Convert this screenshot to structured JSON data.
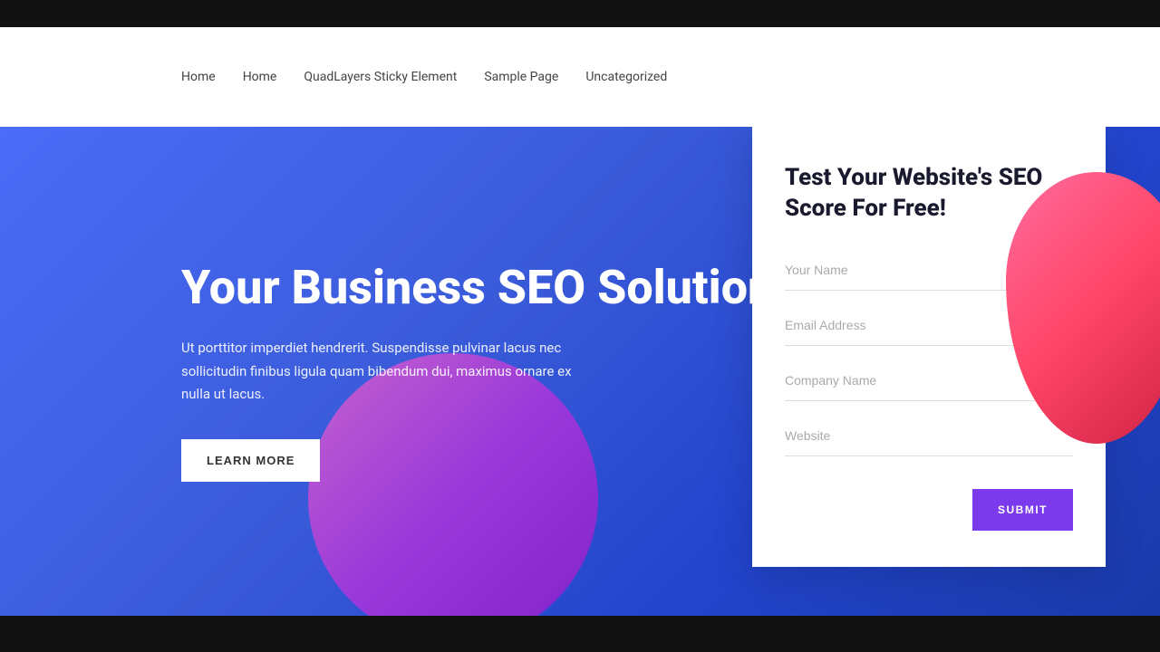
{
  "topbar": {},
  "nav": {
    "links": [
      {
        "label": "Home",
        "id": "nav-home-1"
      },
      {
        "label": "Home",
        "id": "nav-home-2"
      },
      {
        "label": "QuadLayers Sticky Element",
        "id": "nav-quadlayers"
      },
      {
        "label": "Sample Page",
        "id": "nav-sample"
      },
      {
        "label": "Uncategorized",
        "id": "nav-uncategorized"
      }
    ]
  },
  "hero": {
    "title": "Your Business SEO Solution",
    "description": "Ut porttitor imperdiet hendrerit. Suspendisse pulvinar lacus nec sollicitudin finibus ligula quam bibendum dui, maximus ornare ex nulla ut lacus.",
    "learn_more_label": "LEARN MORE"
  },
  "form": {
    "title": "Test Your Website's SEO Score For Free!",
    "fields": [
      {
        "placeholder": "Your Name",
        "id": "field-name",
        "type": "text"
      },
      {
        "placeholder": "Email Address",
        "id": "field-email",
        "type": "email"
      },
      {
        "placeholder": "Company Name",
        "id": "field-company",
        "type": "text"
      },
      {
        "placeholder": "Website",
        "id": "field-website",
        "type": "url"
      }
    ],
    "submit_label": "SUBMIT"
  },
  "colors": {
    "hero_bg_start": "#4a6cf7",
    "hero_bg_end": "#1a3aaa",
    "submit_btn": "#7c3aed",
    "circle_gradient_start": "rgba(255,100,200,0.7)",
    "circle_gradient_end": "rgba(140,30,200,0.9)"
  }
}
